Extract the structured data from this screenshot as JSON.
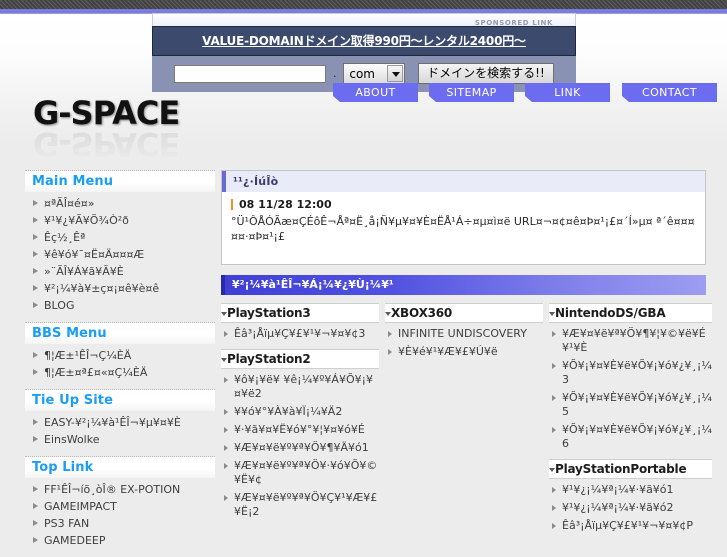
{
  "ad": {
    "sponsored_label": "SPONSORED LINK",
    "title": "VALUE-DOMAINドメイン取得990円～レンタル2400円～",
    "domain_value": "",
    "domain_placeholder": "",
    "dot": ".",
    "tld_selected": "com",
    "submit_label": "ドメインを検索する!!"
  },
  "logo": {
    "text": "G-SPACE"
  },
  "nav": {
    "about": "ABOUT",
    "sitemap": "SITEMAP",
    "link": "LINK",
    "contact": "CONTACT"
  },
  "sidebar": {
    "sections": [
      {
        "title": "Main Menu",
        "items": [
          "¤ªÃÎ¤é¤»",
          "¥¹¥¿¥Ã¥Õ¾Ò²ð",
          "Êç½¸Êª",
          "¥ê¥ó¥¯¤Ë¤Ä¤¤¤Æ",
          "»¨ÃÎ¥Á¥ã¥Ã¥È",
          "¥²¡¼¥à¥±ç¤¡¤ê¥è¤ê",
          "BLOG"
        ]
      },
      {
        "title": "BBS Menu",
        "items": [
          "¶¦Æ±¹ÊÎ¬Ç¼ÈÄ",
          "¶¦Æ±¤ª£¤«¤Ç¼ÈÄ"
        ]
      },
      {
        "title": "Tie Up Site",
        "items": [
          "EASY-¥²¡¼¥à¹ÊÎ¬¥µ¥¤¥È",
          "EinsWolke"
        ]
      },
      {
        "title": "Top Link",
        "items": [
          "FF¹ÊÎ¬íõ¸òÎ® EX-POTION",
          "GAMEIMPACT",
          "PS3 FAN",
          "GAMEDEEP"
        ]
      }
    ]
  },
  "news": {
    "heading": "¹¹¿·ÍúÎò",
    "date": "08 11/28 12:00",
    "body": "°Ü¹ÔÅÓÃæ¤ÇÉôÊ¬Åª¤Ë¸å¡Ñ¥µ¥¤¥È¤ËÅ¹Á÷¤µ¤ì¤ë URL¤¬¤¢¤ê¤Þ¤¹¡£¤´Í»µ¤ ª´ê¤¤¤¤¤·¤Þ¤¹¡£"
  },
  "section_bar": {
    "title": "¥²¡¼¥à¹ÊÎ¬¥Á¡¼¥¿¥Ù¡¼¥¹"
  },
  "groups": {
    "column1": [
      {
        "title": "PlayStation3",
        "items": [
          "Êâ³¡Åïµ¥Ç¥£¥¹¥¬¥¤¥¢3"
        ]
      },
      {
        "title": "PlayStation2",
        "items": [
          "¥ô¥¡¥ë¥ ¥ê¡¼¥º¥Á¥Õ¥¡¥¤¥ë2",
          "¥¥ó¥°¥À¥à¥Ï¡¼¥Ä2",
          "¥·¥ã¥¤¥Ë¥ó¥°¥¦¥¤¥ó¥É",
          "¥Æ¥¤¥ë¥º¥ª¥Ö¥¶¥Ä¥ó1",
          "¥Æ¥¤¥ë¥º¥ª¥Ö¥·¥ó¥Õ¥©¥Ë¥¢",
          "¥Æ¥¤¥ë¥º¥ª¥Ö¥Ç¥¹¥Æ¥£¥Ë¡2"
        ]
      }
    ],
    "column2": [
      {
        "title": "XBOX360",
        "items": [
          "INFINITE UNDISCOVERY",
          "¥È¥é¥¹¥Æ¥£¥Ú¥ë"
        ]
      }
    ],
    "column3": [
      {
        "title": "NintendoDS/GBA",
        "items": [
          "¥Æ¥¤¥ë¥ª¥Ö¥¶¥¦¥©¥ë¥É¥¹¥È",
          "¥Õ¥¡¥¤¥È¥ë¥Õ¥¡¥ó¥¿¥¸¡¼3",
          "¥Õ¥¡¥¤¥È¥ë¥Õ¥¡¥ó¥¿¥¸¡¼5",
          "¥Õ¥¡¥¤¥È¥ë¥Õ¥¡¥ó¥¿¥¸¡¼6"
        ]
      },
      {
        "title": "PlayStationPortable",
        "items": [
          "¥¹¥¿¡¼¥ª¡¼¥·¥ã¥ó1",
          "¥¹¥¿¡¼¥ª¡¼¥·¥ã¥ó2",
          "Êâ³¡Åïµ¥Ç¥£¥¹¥¬¥¤¥¢P"
        ]
      }
    ]
  }
}
